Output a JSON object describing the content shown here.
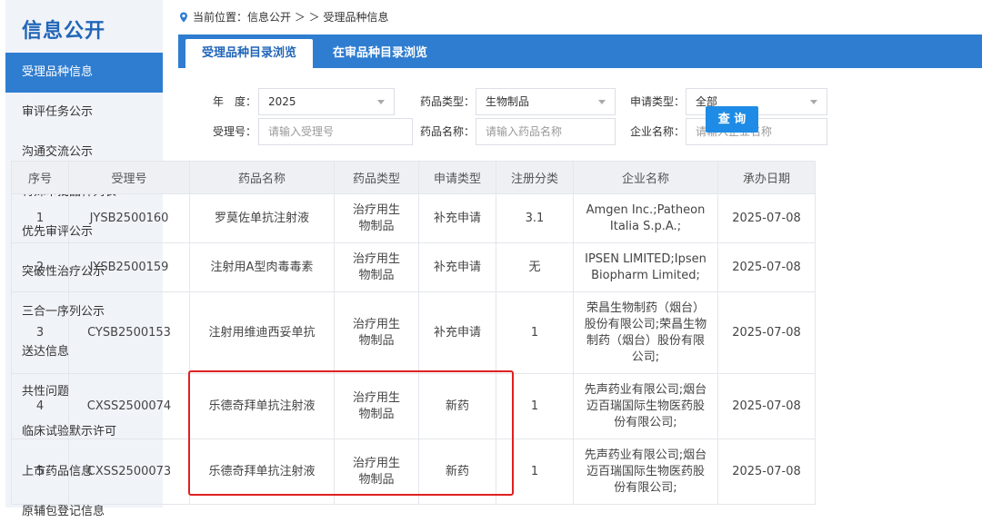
{
  "sidebar": {
    "title": "信息公开",
    "items": [
      {
        "label": "受理品种信息",
        "active": true
      },
      {
        "label": "审评任务公示"
      },
      {
        "label": "沟通交流公示"
      },
      {
        "label": "特殊审批品种列表"
      },
      {
        "label": "优先审评公示"
      },
      {
        "label": "突破性治疗公示"
      },
      {
        "label": "三合一序列公示"
      },
      {
        "label": "送达信息"
      },
      {
        "label": "共性问题"
      },
      {
        "label": "临床试验默示许可"
      },
      {
        "label": "上市药品信息"
      },
      {
        "label": "原辅包登记信息"
      }
    ]
  },
  "breadcrumb": "当前位置：信息公开 ＞ ＞ 受理品种信息",
  "tabs": [
    {
      "label": "受理品种目录浏览",
      "active": true
    },
    {
      "label": "在审品种目录浏览"
    }
  ],
  "filters": {
    "year_label": "年　度：",
    "year_value": "2025",
    "drug_type_label": "药品类型：",
    "drug_type_value": "生物制品",
    "apply_type_label": "申请类型：",
    "apply_type_value": "全部",
    "accept_no_label": "受理号：",
    "accept_no_placeholder": "请输入受理号",
    "drug_name_label": "药品名称：",
    "drug_name_placeholder": "请输入药品名称",
    "company_label": "企业名称：",
    "company_placeholder": "请输入企业名称",
    "search_label": "查 询"
  },
  "table": {
    "headers": [
      "序号",
      "受理号",
      "药品名称",
      "药品类型",
      "申请类型",
      "注册分类",
      "企业名称",
      "承办日期"
    ],
    "rows": [
      [
        "1",
        "JYSB2500160",
        "罗莫佐单抗注射液",
        "治疗用生物制品",
        "补充申请",
        "3.1",
        "Amgen Inc.;Patheon Italia S.p.A.;",
        "2025-07-08"
      ],
      [
        "2",
        "JYSB2500159",
        "注射用A型肉毒毒素",
        "治疗用生物制品",
        "补充申请",
        "无",
        "IPSEN LIMITED;Ipsen Biopharm Limited;",
        "2025-07-08"
      ],
      [
        "3",
        "CYSB2500153",
        "注射用维迪西妥单抗",
        "治疗用生物制品",
        "补充申请",
        "1",
        "荣昌生物制药（烟台）股份有限公司;荣昌生物制药（烟台）股份有限公司;",
        "2025-07-08"
      ],
      [
        "4",
        "CXSS2500074",
        "乐德奇拜单抗注射液",
        "治疗用生物制品",
        "新药",
        "1",
        "先声药业有限公司;烟台迈百瑞国际生物医药股份有限公司;",
        "2025-07-08"
      ],
      [
        "5",
        "CXSS2500073",
        "乐德奇拜单抗注射液",
        "治疗用生物制品",
        "新药",
        "1",
        "先声药业有限公司;烟台迈百瑞国际生物医药股份有限公司;",
        "2025-07-08"
      ]
    ]
  },
  "colors": {
    "accent": "#2f7dd0",
    "title": "#2166b8",
    "highlight": "#e02020"
  }
}
